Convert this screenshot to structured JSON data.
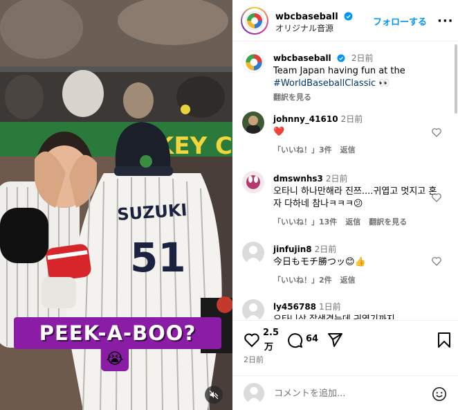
{
  "video": {
    "caption": "PEEK-A-BOO?",
    "caption_emoji": "😭",
    "jersey_name": "SUZUKI",
    "jersey_number": "51",
    "banner_text": "KEY CO",
    "mute_icon": "speaker-muted-icon"
  },
  "header": {
    "username": "wbcbaseball",
    "subtitle": "オリジナル音源",
    "follow_label": "フォローする",
    "more_label": "···"
  },
  "caption_post": {
    "username": "wbcbaseball",
    "time": "2日前",
    "text": "Team Japan having fun at the",
    "hashtag": "#WorldBaseballClassic",
    "emoji": "👀",
    "translate": "翻訳を見る"
  },
  "comments": [
    {
      "username": "johnny_41610",
      "time": "2日前",
      "text": "❤️",
      "likes": "「いいね！」3件",
      "reply": "返信",
      "translate": ""
    },
    {
      "username": "dmswnhs3",
      "time": "2日前",
      "text": "오타니 하나만해라 진쯔....귀엽고 멋지고 혼자 다하네 참나ㅋㅋㅋ😕",
      "likes": "「いいね！」13件",
      "reply": "返信",
      "translate": "翻訳を見る"
    },
    {
      "username": "jinfujin8",
      "time": "2日前",
      "text": "今日もモチ勝つッ😊👍",
      "likes": "「いいね！」2件",
      "reply": "返信",
      "translate": ""
    },
    {
      "username": "ly456788",
      "time": "1日前",
      "text": "오타니상 잘생겼는데 귀엽기까지",
      "likes": "",
      "reply": "",
      "translate": ""
    }
  ],
  "actions": {
    "like_count_top": "2.5",
    "like_count_bottom": "万",
    "comment_count": "64",
    "date": "2日前"
  },
  "add_comment": {
    "placeholder": "コメントを追加...",
    "emoji_icon": "smiley-icon"
  },
  "colors": {
    "accent": "#0095f6",
    "caption_bg": "#8a1ca6",
    "heart_red": "#ed1c24"
  }
}
